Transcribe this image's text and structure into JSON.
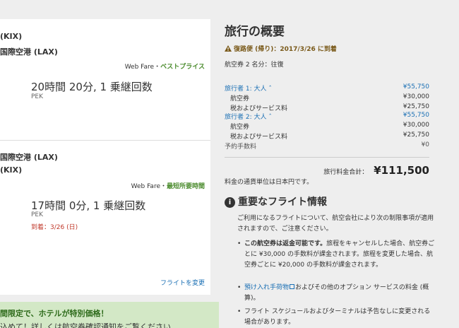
{
  "left": {
    "flight1": {
      "origin": "(KIX)",
      "destination": "国際空港 (LAX)",
      "fare_prefix": "Web Fare・",
      "fare_tag": "ベストプライス",
      "duration": "20時間 20分, 1 乗継回数",
      "code": "PEK"
    },
    "flight2": {
      "origin": "国際空港 (LAX)",
      "destination": "(KIX)",
      "fare_prefix": "Web Fare・",
      "fare_tag": "最短所要時間",
      "duration": "17時間 0分, 1 乗継回数",
      "code": "PEK",
      "arrival": "到着：3/26 (日)"
    },
    "change_flight": "フライトを変更",
    "promo_title": "間限定で、ホテルが特別価格！",
    "promo_text": "込めて！詳しくは航空券確認通知をご覧ください"
  },
  "summary": {
    "title": "旅行の概要",
    "return_notice": "復路便 (帰り)：2017/3/26 に到着",
    "tickets": "航空券 2 名分：往復",
    "travelers": [
      {
        "label": "旅行者 1: 大人 ˆ",
        "amount": "¥55,750",
        "items": [
          {
            "label": "航空券",
            "amount": "¥30,000"
          },
          {
            "label": "税およびサービス料",
            "amount": "¥25,750"
          }
        ]
      },
      {
        "label": "旅行者 2: 大人 ˆ",
        "amount": "¥55,750",
        "items": [
          {
            "label": "航空券",
            "amount": "¥30,000"
          },
          {
            "label": "税およびサービス料",
            "amount": "¥25,750"
          }
        ]
      }
    ],
    "booking_fee_label": "予約手数料",
    "booking_fee": "¥0",
    "total_label": "旅行料金合計：",
    "total": "¥111,500",
    "currency_note": "料金の通貨単位は日本円です。"
  },
  "info": {
    "title": "重要なフライト情報",
    "intro": "ご利用になるフライトについて、航空会社により次の制限事項が適用されますので、ご注意ください。",
    "b1_bold": "この航空券は返金可能です。",
    "b1_text": "旅程をキャンセルした場合、航空券ごとに ¥30,000 の手数料が課金されます。旅程を変更した場合、航空券ごとに ¥20,000 の手数料が課金されます。",
    "b2_link": "預け入れ手荷物",
    "b2_text": "およびその他のオプション サービスの料金 (概算)。",
    "b3_text": "フライト スケジュールおよびターミナルは予告なしに変更される場合があります。"
  },
  "colors": {
    "link": "#1a6fb4",
    "green": "#4a8b2c",
    "warning": "#7a5a1a",
    "promo_bg": "#d3e8c6"
  }
}
